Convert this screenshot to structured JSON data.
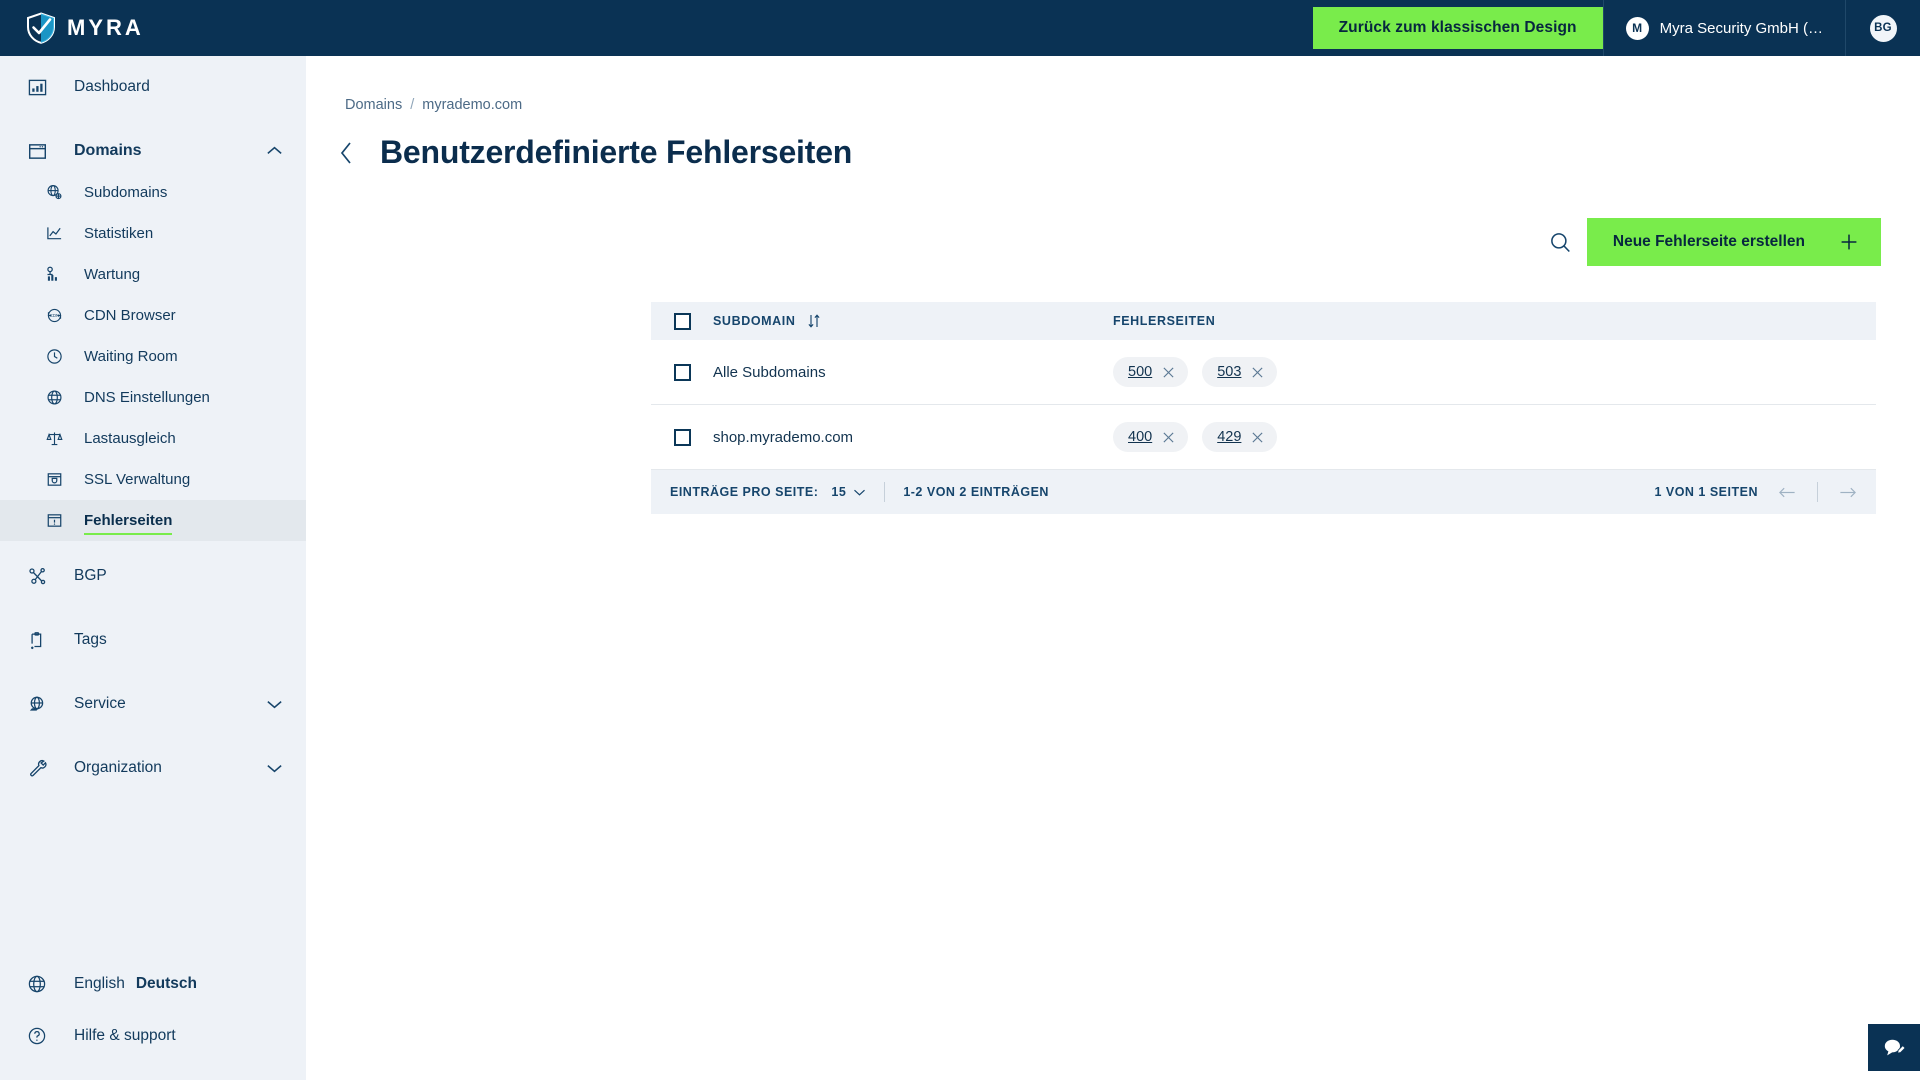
{
  "brand": {
    "name": "MYRA",
    "logo_icon": "shield-icon",
    "primary_dark": "#0a3254",
    "accent_green": "#79ec4b",
    "sidebar_bg": "#eef2f7"
  },
  "header": {
    "back_to_classic_label": "Zurück zum klassischen Design",
    "org_initial": "M",
    "org_name": "Myra Security GmbH (…",
    "user_initials": "BG"
  },
  "sidebar": {
    "items": [
      {
        "label": "Dashboard",
        "icon": "dashboard-chart-icon",
        "level": "top",
        "state": "normal"
      },
      {
        "label": "Domains",
        "icon": "browser-window-icon",
        "level": "top",
        "state": "expanded",
        "chevron": "chevron-up-icon"
      },
      {
        "label": "Subdomains",
        "icon": "globe-network-icon",
        "level": "sub",
        "state": "normal"
      },
      {
        "label": "Statistiken",
        "icon": "line-chart-icon",
        "level": "sub",
        "state": "normal"
      },
      {
        "label": "Wartung",
        "icon": "maintenance-icon",
        "level": "sub",
        "state": "normal"
      },
      {
        "label": "CDN Browser",
        "icon": "cdn-refresh-icon",
        "level": "sub",
        "state": "normal"
      },
      {
        "label": "Waiting Room",
        "icon": "clock-icon",
        "level": "sub",
        "state": "normal"
      },
      {
        "label": "DNS Einstellungen",
        "icon": "globe-icon",
        "level": "sub",
        "state": "normal"
      },
      {
        "label": "Lastausgleich",
        "icon": "balance-scale-icon",
        "level": "sub",
        "state": "normal"
      },
      {
        "label": "SSL Verwaltung",
        "icon": "ssl-shield-icon",
        "level": "sub",
        "state": "normal"
      },
      {
        "label": "Fehlerseiten",
        "icon": "error-page-icon",
        "level": "sub",
        "state": "active"
      },
      {
        "label": "BGP",
        "icon": "bgp-nodes-icon",
        "level": "top",
        "state": "normal"
      },
      {
        "label": "Tags",
        "icon": "tag-clipboard-icon",
        "level": "top",
        "state": "normal"
      },
      {
        "label": "Service",
        "icon": "service-globe-icon",
        "level": "top",
        "state": "collapsed",
        "chevron": "chevron-down-icon"
      },
      {
        "label": "Organization",
        "icon": "wrench-icon",
        "level": "top",
        "state": "collapsed",
        "chevron": "chevron-down-icon"
      }
    ],
    "language": {
      "icon": "globe-icon",
      "english_label": "English",
      "german_label": "Deutsch",
      "selected": "Deutsch"
    },
    "help": {
      "icon": "question-circle-icon",
      "label": "Hilfe & support"
    }
  },
  "main": {
    "breadcrumb": {
      "root": "Domains",
      "separator": "/",
      "current": "myrademo.com"
    },
    "back_icon": "chevron-left-icon",
    "page_title": "Benutzerdefinierte Fehlerseiten",
    "toolbar": {
      "search_icon": "search-icon",
      "create_label": "Neue Fehlerseite erstellen",
      "create_icon": "plus-icon"
    },
    "table": {
      "columns": [
        {
          "key": "subdomain",
          "label": "SUBDOMAIN",
          "sort_icon": "sort-updown-icon"
        },
        {
          "key": "errors",
          "label": "FEHLERSEITEN"
        }
      ],
      "select_all_checked": false,
      "rows": [
        {
          "selected": false,
          "subdomain": "Alle Subdomains",
          "errors": [
            {
              "code": "500",
              "remove_icon": "close-icon"
            },
            {
              "code": "503",
              "remove_icon": "close-icon"
            }
          ]
        },
        {
          "selected": false,
          "subdomain": "shop.myrademo.com",
          "errors": [
            {
              "code": "400",
              "remove_icon": "close-icon"
            },
            {
              "code": "429",
              "remove_icon": "close-icon"
            }
          ]
        }
      ],
      "footer": {
        "per_page_label": "EINTRÄGE PRO SEITE:",
        "per_page_value": "15",
        "per_page_chevron": "chevron-down-icon",
        "range_label": "1-2 VON 2 EINTRÄGEN",
        "pages_label": "1 VON 1 SEITEN",
        "prev_icon": "arrow-left-icon",
        "next_icon": "arrow-right-icon"
      }
    }
  },
  "chat": {
    "icon": "chat-compose-icon"
  }
}
